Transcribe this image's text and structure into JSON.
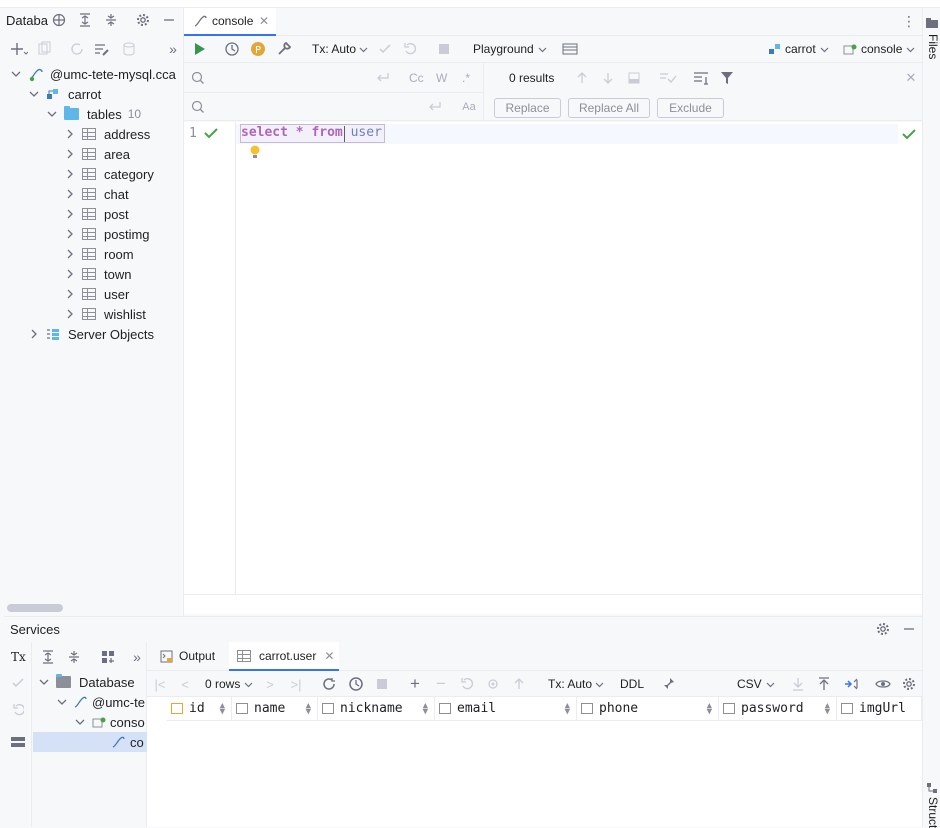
{
  "db_panel": {
    "title": "Databa",
    "tree": [
      {
        "label": "@umc-tete-mysql.cca",
        "level": 0
      },
      {
        "label": "carrot",
        "level": 1
      },
      {
        "label": "tables",
        "count": "10",
        "level": 2
      },
      {
        "label": "address"
      },
      {
        "label": "area"
      },
      {
        "label": "category"
      },
      {
        "label": "chat"
      },
      {
        "label": "post"
      },
      {
        "label": "postimg"
      },
      {
        "label": "room"
      },
      {
        "label": "town"
      },
      {
        "label": "user"
      },
      {
        "label": "wishlist"
      },
      {
        "label": "Server Objects",
        "level": 1
      }
    ]
  },
  "editor": {
    "tab_label": "console",
    "toolbar": {
      "tx_mode": "Tx: Auto",
      "playground": "Playground",
      "schema": "carrot",
      "session": "console"
    },
    "search": {
      "results": "0 results",
      "cc": "Cc",
      "w": "W",
      "regex": ".*",
      "replace": "Replace",
      "replace_all": "Replace All",
      "exclude": "Exclude"
    },
    "line_number": "1",
    "code": {
      "kw1": "select",
      "star": "*",
      "kw2": "from",
      "table": "user"
    }
  },
  "right_strip": {
    "files": "Files",
    "structure": "Struct"
  },
  "services": {
    "title": "Services",
    "tx_label": "Tx",
    "tree": {
      "root": "Database",
      "host": "@umc-te",
      "console": "conso",
      "session": "co"
    },
    "tabs": {
      "output": "Output",
      "result": "carrot.user"
    },
    "toolbar": {
      "rows": "0 rows",
      "tx_mode": "Tx: Auto",
      "ddl": "DDL",
      "csv": "CSV"
    },
    "columns": [
      "id",
      "name",
      "nickname",
      "email",
      "phone",
      "password",
      "imgUrl"
    ]
  },
  "colors": {
    "accent": "#3574f0",
    "run_green": "#369650",
    "keyword": "#871094"
  }
}
